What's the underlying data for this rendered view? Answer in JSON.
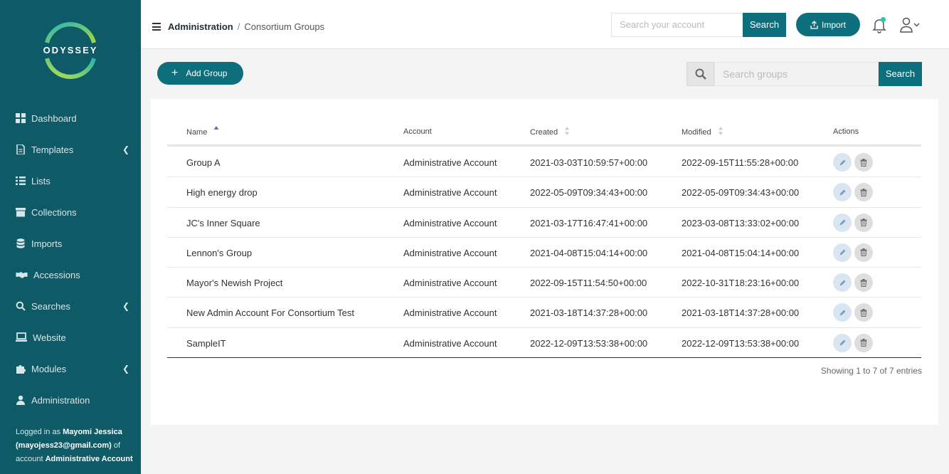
{
  "brand": {
    "logo_text": "ODYSSEY"
  },
  "sidebar": {
    "items": [
      {
        "label": "Dashboard",
        "icon": "dashboard-icon",
        "has_submenu": false
      },
      {
        "label": "Templates",
        "icon": "file-icon",
        "has_submenu": true
      },
      {
        "label": "Lists",
        "icon": "list-icon",
        "has_submenu": false
      },
      {
        "label": "Collections",
        "icon": "archive-icon",
        "has_submenu": false
      },
      {
        "label": "Imports",
        "icon": "database-icon",
        "has_submenu": false
      },
      {
        "label": "Accessions",
        "icon": "handshake-icon",
        "has_submenu": false
      },
      {
        "label": "Searches",
        "icon": "search-icon",
        "has_submenu": true
      },
      {
        "label": "Website",
        "icon": "laptop-icon",
        "has_submenu": false
      },
      {
        "label": "Modules",
        "icon": "puzzle-icon",
        "has_submenu": true
      },
      {
        "label": "Administration",
        "icon": "user-icon",
        "has_submenu": false
      }
    ],
    "logged_in": {
      "prefix": "Logged in as ",
      "user": "Mayomi Jessica (mayojess23@gmail.com)",
      "middle": " of account ",
      "account": "Administrative Account"
    }
  },
  "topbar": {
    "breadcrumb": {
      "parent": "Administration",
      "separator": "/",
      "current": "Consortium Groups"
    },
    "account_search": {
      "placeholder": "Search your account",
      "button": "Search"
    },
    "import_label": "Import",
    "notification_badge_color": "#2ec5a1"
  },
  "toolbar": {
    "add_group_label": "Add Group",
    "group_search": {
      "placeholder": "Search groups",
      "button": "Search"
    }
  },
  "table": {
    "columns": [
      "Name",
      "Account",
      "Created",
      "Modified",
      "Actions"
    ],
    "rows": [
      {
        "name": "Group A",
        "account": "Administrative Account",
        "created": "2021-03-03T10:59:57+00:00",
        "modified": "2022-09-15T11:55:28+00:00"
      },
      {
        "name": "High energy drop",
        "account": "Administrative Account",
        "created": "2022-05-09T09:34:43+00:00",
        "modified": "2022-05-09T09:34:43+00:00"
      },
      {
        "name": "JC's Inner Square",
        "account": "Administrative Account",
        "created": "2021-03-17T16:47:41+00:00",
        "modified": "2023-03-08T13:33:02+00:00"
      },
      {
        "name": "Lennon's Group",
        "account": "Administrative Account",
        "created": "2021-04-08T15:04:14+00:00",
        "modified": "2021-04-08T15:04:14+00:00"
      },
      {
        "name": "Mayor's Newish Project",
        "account": "Administrative Account",
        "created": "2022-09-15T11:54:50+00:00",
        "modified": "2022-10-31T18:23:16+00:00"
      },
      {
        "name": "New Admin Account For Consortium Test",
        "account": "Administrative Account",
        "created": "2021-03-18T14:37:28+00:00",
        "modified": "2021-03-18T14:37:28+00:00"
      },
      {
        "name": "SampleIT",
        "account": "Administrative Account",
        "created": "2022-12-09T13:53:38+00:00",
        "modified": "2022-12-09T13:53:38+00:00"
      }
    ],
    "info": "Showing 1 to 7 of 7 entries"
  },
  "colors": {
    "primary": "#0e6f7c",
    "sidebar": "#0e5a66"
  }
}
